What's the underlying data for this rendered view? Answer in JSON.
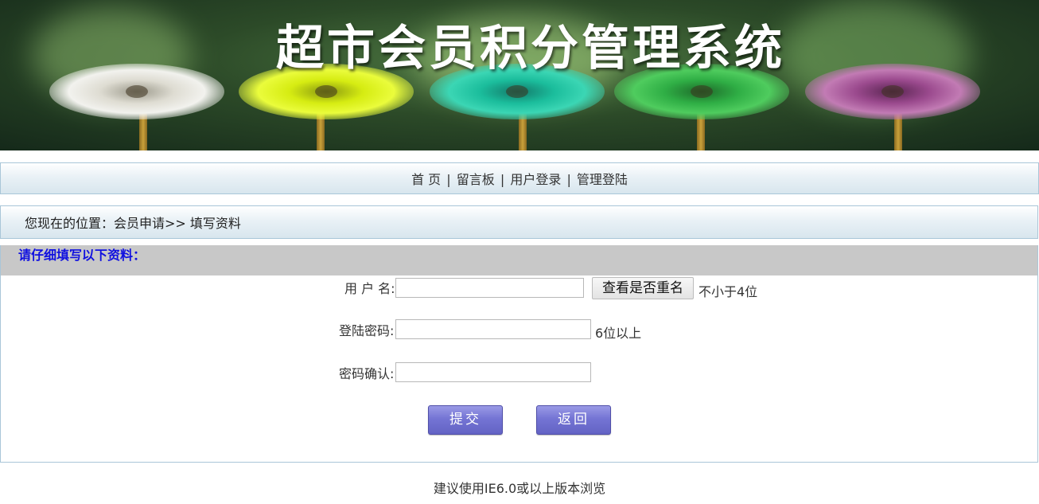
{
  "banner": {
    "title": "超市会员积分管理系统"
  },
  "nav": {
    "items": [
      "首 页",
      "留言板",
      "用户登录",
      "管理登陆"
    ],
    "separator": "|"
  },
  "breadcrumb": {
    "text": "您现在的位置：会员申请>> 填写资料"
  },
  "form": {
    "heading": "请仔细填写以下资料：",
    "username_label": "用 户 名:",
    "username_value": "",
    "check_button": "查看是否重名",
    "username_hint": "不小于4位",
    "password_label": "登陆密码:",
    "password_value": "",
    "password_hint": "6位以上",
    "confirm_label": "密码确认:",
    "confirm_value": "",
    "submit_button": "提交",
    "back_button": "返回"
  },
  "footer": {
    "text": "建议使用IE6.0或以上版本浏览"
  },
  "colors": {
    "heading_blue": "#1010e0",
    "button_purple": "#7474d4",
    "border_blue": "#a9c6d8",
    "header_gray": "#c8c8c8"
  }
}
